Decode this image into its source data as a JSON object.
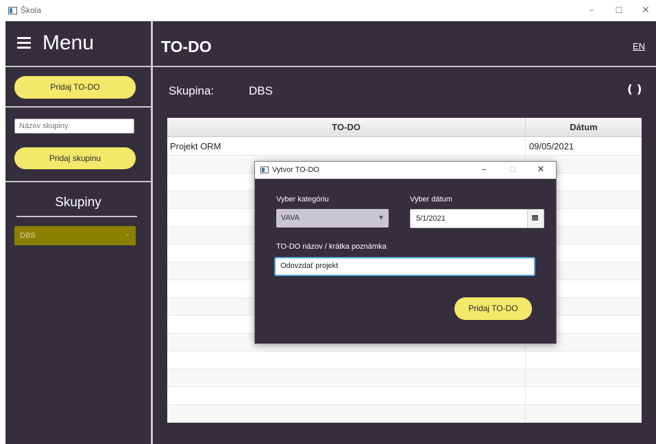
{
  "window": {
    "title": "Škola",
    "controls": [
      "–",
      "☐",
      "✕"
    ]
  },
  "sidebar": {
    "menu_title": "Menu",
    "add_todo_label": "Pridaj TO-DO",
    "group_name_placeholder": "Názov skupiny",
    "add_group_label": "Pridaj skupinu",
    "groups_title": "Skupiny",
    "selected_group": "DBS"
  },
  "header": {
    "title": "TO-DO",
    "language": "EN"
  },
  "main": {
    "group_label": "Skupina:",
    "group_value": "DBS",
    "refresh_icon": "refresh-icon"
  },
  "table": {
    "columns": [
      "TO-DO",
      "Dátum"
    ],
    "rows": [
      {
        "todo": "Projekt ORM",
        "date": "09/05/2021"
      },
      {
        "todo": "",
        "date": ""
      },
      {
        "todo": "",
        "date": ""
      },
      {
        "todo": "",
        "date": ""
      },
      {
        "todo": "",
        "date": ""
      },
      {
        "todo": "",
        "date": ""
      },
      {
        "todo": "",
        "date": ""
      },
      {
        "todo": "",
        "date": ""
      },
      {
        "todo": "",
        "date": ""
      },
      {
        "todo": "",
        "date": ""
      },
      {
        "todo": "",
        "date": ""
      },
      {
        "todo": "",
        "date": ""
      },
      {
        "todo": "",
        "date": ""
      },
      {
        "todo": "",
        "date": ""
      },
      {
        "todo": "",
        "date": ""
      },
      {
        "todo": "",
        "date": ""
      }
    ]
  },
  "dialog": {
    "title": "Vytvor TO-DO",
    "category_label": "Vyber kategóriu",
    "category_value": "VAVA",
    "date_label": "Vyber dátum",
    "date_value": "5/1/2021",
    "todo_name_label": "TO-DO názov / krátka poznámka",
    "todo_name_value": "Odovzdať projekt",
    "add_button_label": "Pridaj TO-DO"
  },
  "colors": {
    "background": "#342e3d",
    "accent_yellow": "#f3e86a",
    "group_select": "#8a7f00",
    "focus_blue": "#4fa3d9"
  }
}
